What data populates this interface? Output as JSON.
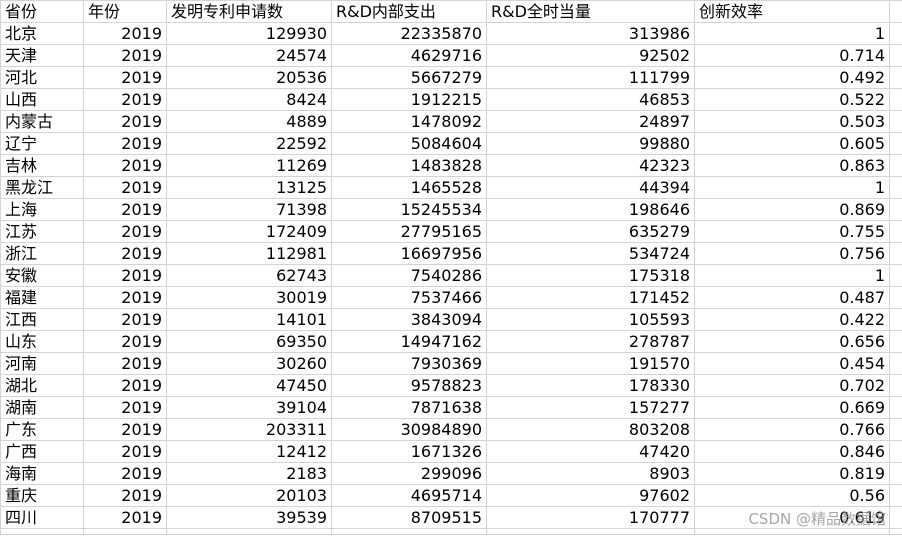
{
  "headers": [
    "省份",
    "年份",
    "发明专利申请数",
    "R&D内部支出",
    "R&D全时当量",
    "创新效率"
  ],
  "rows": [
    [
      "北京",
      "2019",
      "129930",
      "22335870",
      "313986",
      "1"
    ],
    [
      "天津",
      "2019",
      "24574",
      "4629716",
      "92502",
      "0.714"
    ],
    [
      "河北",
      "2019",
      "20536",
      "5667279",
      "111799",
      "0.492"
    ],
    [
      "山西",
      "2019",
      "8424",
      "1912215",
      "46853",
      "0.522"
    ],
    [
      "内蒙古",
      "2019",
      "4889",
      "1478092",
      "24897",
      "0.503"
    ],
    [
      "辽宁",
      "2019",
      "22592",
      "5084604",
      "99880",
      "0.605"
    ],
    [
      "吉林",
      "2019",
      "11269",
      "1483828",
      "42323",
      "0.863"
    ],
    [
      "黑龙江",
      "2019",
      "13125",
      "1465528",
      "44394",
      "1"
    ],
    [
      "上海",
      "2019",
      "71398",
      "15245534",
      "198646",
      "0.869"
    ],
    [
      "江苏",
      "2019",
      "172409",
      "27795165",
      "635279",
      "0.755"
    ],
    [
      "浙江",
      "2019",
      "112981",
      "16697956",
      "534724",
      "0.756"
    ],
    [
      "安徽",
      "2019",
      "62743",
      "7540286",
      "175318",
      "1"
    ],
    [
      "福建",
      "2019",
      "30019",
      "7537466",
      "171452",
      "0.487"
    ],
    [
      "江西",
      "2019",
      "14101",
      "3843094",
      "105593",
      "0.422"
    ],
    [
      "山东",
      "2019",
      "69350",
      "14947162",
      "278787",
      "0.656"
    ],
    [
      "河南",
      "2019",
      "30260",
      "7930369",
      "191570",
      "0.454"
    ],
    [
      "湖北",
      "2019",
      "47450",
      "9578823",
      "178330",
      "0.702"
    ],
    [
      "湖南",
      "2019",
      "39104",
      "7871638",
      "157277",
      "0.669"
    ],
    [
      "广东",
      "2019",
      "203311",
      "30984890",
      "803208",
      "0.766"
    ],
    [
      "广西",
      "2019",
      "12412",
      "1671326",
      "47420",
      "0.846"
    ],
    [
      "海南",
      "2019",
      "2183",
      "299096",
      "8903",
      "0.819"
    ],
    [
      "重庆",
      "2019",
      "20103",
      "4695714",
      "97602",
      "0.56"
    ],
    [
      "四川",
      "2019",
      "39539",
      "8709515",
      "170777",
      "0.619"
    ]
  ],
  "watermark": "CSDN @精品数据馆"
}
